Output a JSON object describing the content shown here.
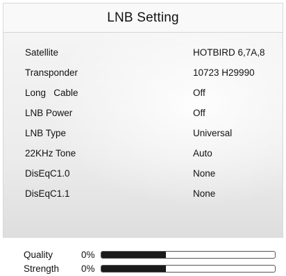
{
  "window": {
    "title": "LNB Setting"
  },
  "settings": [
    {
      "label": "Satellite",
      "value": "HOTBIRD 6,7A,8"
    },
    {
      "label": "Transponder",
      "value": "10723 H29990"
    },
    {
      "label": "Long   Cable",
      "value": "Off"
    },
    {
      "label": "LNB Power",
      "value": "Off"
    },
    {
      "label": "LNB Type",
      "value": "Universal"
    },
    {
      "label": "22KHz Tone",
      "value": "Auto"
    },
    {
      "label": "DisEqC1.0",
      "value": "None"
    },
    {
      "label": "DisEqC1.1",
      "value": "None"
    }
  ],
  "signal": {
    "quality": {
      "label": "Quality",
      "percent_text": "0%",
      "bar_fill_fraction": 0.37
    },
    "strength": {
      "label": "Strength",
      "percent_text": "0%",
      "bar_fill_fraction": 0.37
    }
  }
}
